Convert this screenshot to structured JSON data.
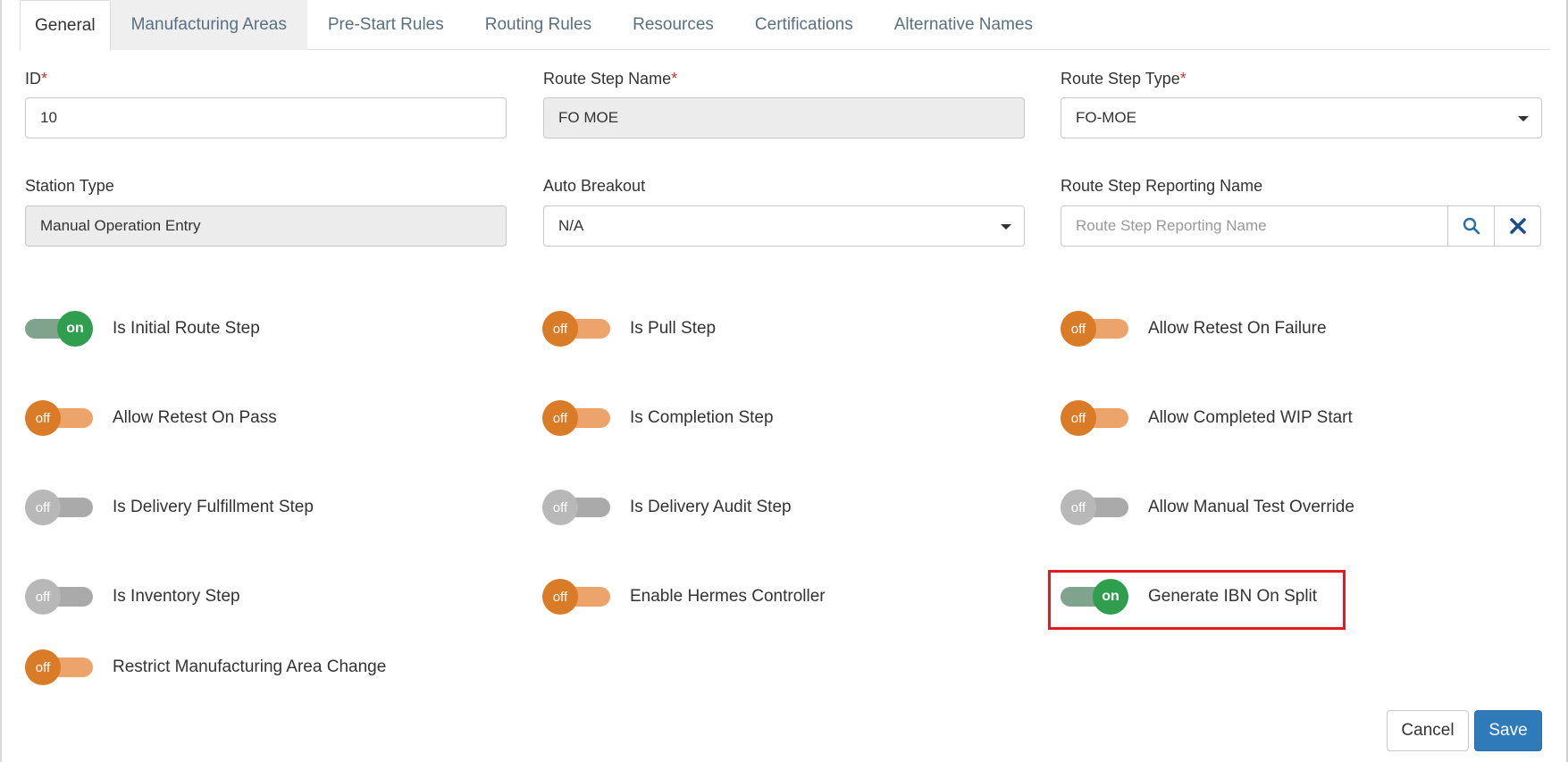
{
  "tabs": [
    "General",
    "Manufacturing Areas",
    "Pre-Start Rules",
    "Routing Rules",
    "Resources",
    "Certifications",
    "Alternative Names"
  ],
  "fields": {
    "id": {
      "label": "ID",
      "required": "*",
      "value": "10"
    },
    "route_step_name": {
      "label": "Route Step Name",
      "required": "*",
      "value": "FO MOE"
    },
    "route_step_type": {
      "label": "Route Step Type",
      "required": "*",
      "value": "FO-MOE"
    },
    "station_type": {
      "label": "Station Type",
      "value": "Manual Operation Entry"
    },
    "auto_breakout": {
      "label": "Auto Breakout",
      "value": "N/A"
    },
    "reporting_name": {
      "label": "Route Step Reporting Name",
      "placeholder": "Route Step Reporting Name"
    }
  },
  "toggles": [
    {
      "label": "Is Initial Route Step",
      "state": "on"
    },
    {
      "label": "Is Pull Step",
      "state": "off"
    },
    {
      "label": "Allow Retest On Failure",
      "state": "off"
    },
    {
      "label": "Allow Retest On Pass",
      "state": "off"
    },
    {
      "label": "Is Completion Step",
      "state": "off"
    },
    {
      "label": "Allow Completed WIP Start",
      "state": "off"
    },
    {
      "label": "Is Delivery Fulfillment Step",
      "state": "off"
    },
    {
      "label": "Is Delivery Audit Step",
      "state": "off"
    },
    {
      "label": "Allow Manual Test Override",
      "state": "off"
    },
    {
      "label": "Is Inventory Step",
      "state": "off"
    },
    {
      "label": "Enable Hermes Controller",
      "state": "off"
    },
    {
      "label": "Generate IBN On Split",
      "state": "on"
    },
    {
      "label": "Restrict Manufacturing Area Change",
      "state": "off"
    }
  ],
  "actions": {
    "cancel": "Cancel",
    "save": "Save"
  },
  "colors": {
    "on": "#2f9e4f",
    "off_orange": "#d97b27",
    "off_gray": "#b8b8b8",
    "primary": "#2f7ab8",
    "highlight": "#e01b24"
  }
}
